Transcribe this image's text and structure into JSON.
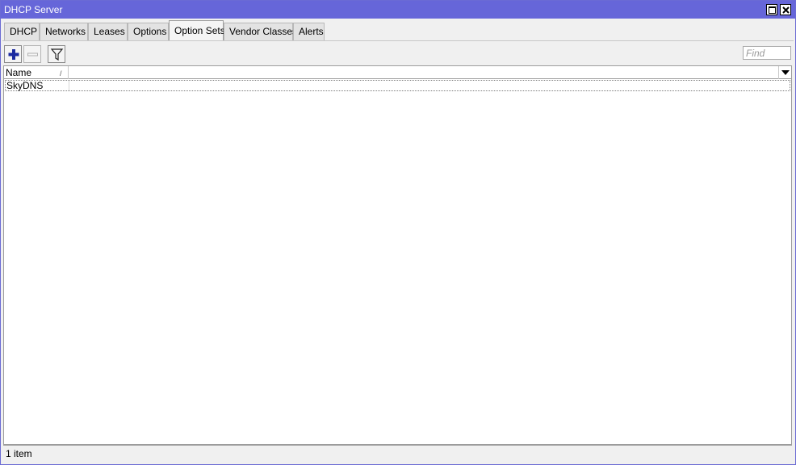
{
  "window": {
    "title": "DHCP Server",
    "maximize_icon": "maximize-icon",
    "close_icon": "close-icon",
    "title_bar_color": "#6666d9"
  },
  "tabs": [
    {
      "label": "DHCP",
      "active": false
    },
    {
      "label": "Networks",
      "active": false
    },
    {
      "label": "Leases",
      "active": false
    },
    {
      "label": "Options",
      "active": false
    },
    {
      "label": "Option Sets",
      "active": true
    },
    {
      "label": "Vendor Classes",
      "active": false
    },
    {
      "label": "Alerts",
      "active": false
    }
  ],
  "toolbar": {
    "add_icon": "plus-icon",
    "remove_icon": "minus-icon",
    "filter_icon": "filter-icon",
    "find_placeholder": "Find",
    "find_value": ""
  },
  "table": {
    "columns": [
      {
        "label": "Name",
        "sort": "ascending"
      }
    ],
    "column_menu_icon": "triangle-down-icon",
    "rows": [
      {
        "name": "SkyDNS"
      }
    ]
  },
  "status": {
    "count": "1 item"
  }
}
